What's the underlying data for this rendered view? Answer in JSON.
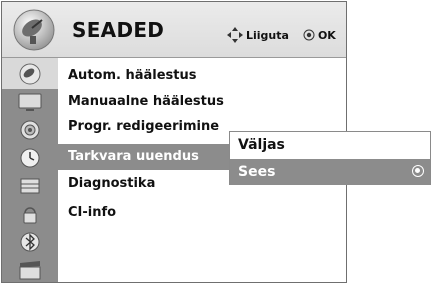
{
  "header": {
    "title": "SEADED",
    "icon": "satellite-dish-icon",
    "hint_move_label": "Liiguta",
    "hint_ok_label": "OK"
  },
  "menu": {
    "items": [
      {
        "label": "Autom. häälestus"
      },
      {
        "label": "Manuaalne häälestus"
      },
      {
        "label": "Progr. redigeerimine"
      },
      {
        "label": "Tarkvara uuendus",
        "selected": true
      },
      {
        "label": "Diagnostika"
      },
      {
        "label": "CI-info"
      }
    ]
  },
  "sidebar_icons": [
    "satellite-dish-icon",
    "tv-icon",
    "speaker-icon",
    "clock-icon",
    "lock-icon",
    "input-icon",
    "bluetooth-icon",
    "media-icon"
  ],
  "submenu": {
    "options": [
      {
        "label": "Väljas"
      },
      {
        "label": "Sees",
        "selected": true
      }
    ]
  },
  "colors": {
    "highlight": "#8c8c8c",
    "header_bg": "#e3e3e3"
  }
}
